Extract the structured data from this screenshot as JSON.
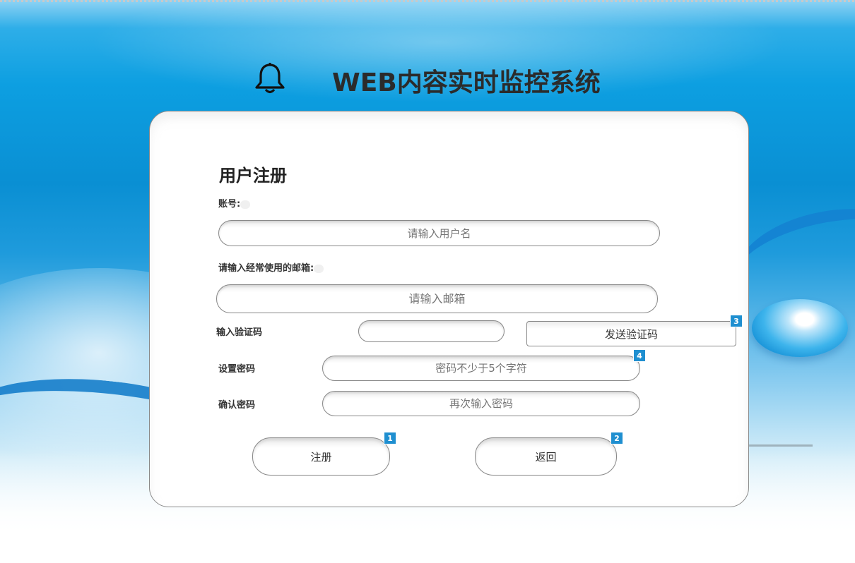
{
  "header": {
    "title": "WEB内容实时监控系统",
    "icon": "bell-icon"
  },
  "form": {
    "heading": "用户注册",
    "account_label": "账号:",
    "account_placeholder": "请输入用户名",
    "email_label": "请输入经常使用的邮箱:",
    "email_placeholder": "请输入邮箱",
    "code_label": "输入验证码",
    "code_value": "",
    "send_code_label": "发送验证码",
    "password_label": "设置密码",
    "password_placeholder": "密码不少于5个字符",
    "confirm_label": "确认密码",
    "confirm_placeholder": "再次输入密码",
    "register_label": "注册",
    "back_label": "返回"
  },
  "badges": {
    "register": "1",
    "back": "2",
    "send_code": "3",
    "password": "4"
  },
  "colors": {
    "badge": "#1f8fd0",
    "background_blue": "#0d9fe1",
    "title_text": "#2b2b2b"
  }
}
